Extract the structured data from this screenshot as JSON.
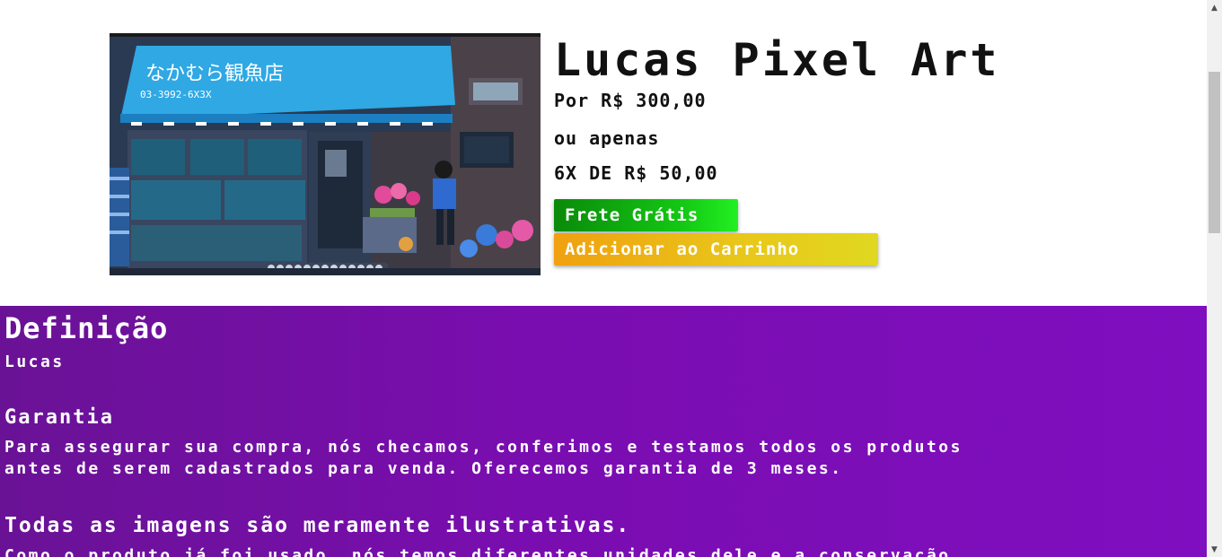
{
  "product": {
    "image_alt": "pixel art shop scene",
    "image_sign_text": "なかむら観魚店",
    "image_sign_phone": "03-3992-6X3X",
    "title": "Lucas Pixel Art",
    "price_line": "Por R$ 300,00",
    "or_line": "ou apenas",
    "installments_line": "6X DE R$ 50,00",
    "shipping_button": "Frete Grátis",
    "cart_button": "Adicionar ao Carrinho"
  },
  "details": {
    "definition_heading": "Definição",
    "definition_text": "Lucas",
    "warranty_heading": "Garantia",
    "warranty_text_line1": "Para assegurar sua compra, nós checamos, conferimos e testamos todos os produtos",
    "warranty_text_line2": "antes de serem cadastrados para venda. Oferecemos garantia de 3 meses.",
    "images_heading": "Todas as imagens são meramente ilustrativas.",
    "images_text": "Como o produto já foi usado, nós temos diferentes unidades dele e a conservação"
  },
  "colors": {
    "details_bg": "#7a0db0",
    "shipping_green": "#14c814",
    "cart_yellow": "#e8c81a"
  },
  "icons": {
    "scroll_up": "▲",
    "scroll_down": "▼"
  }
}
